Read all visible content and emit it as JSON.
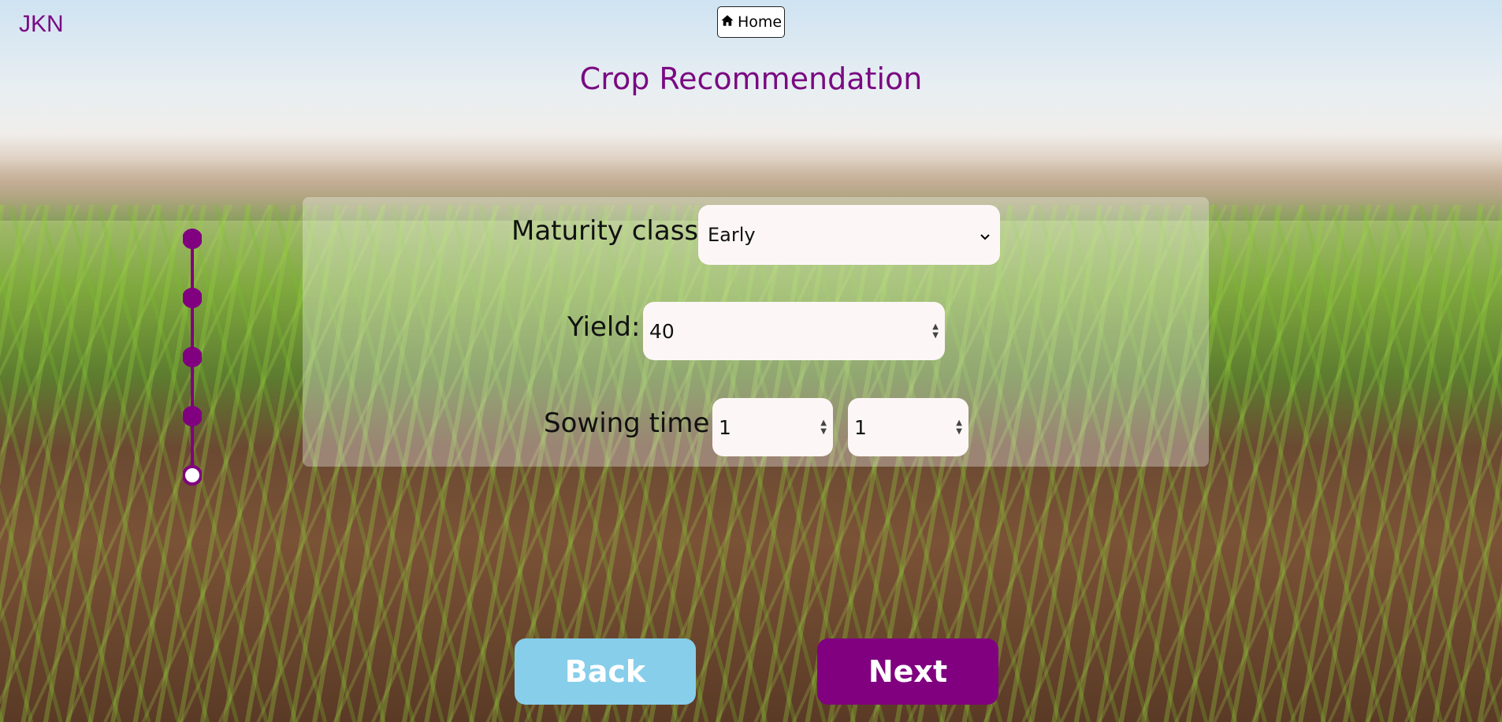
{
  "logo": "JKN",
  "home": {
    "label": "Home",
    "icon": "home-icon"
  },
  "title": "Crop Recommendation",
  "form": {
    "maturity_label": "Maturity class:",
    "maturity_value": "Early",
    "yield_label": "Yield:",
    "yield_value": "40",
    "sowing_label": "Sowing time:",
    "sowing_value_1": "1",
    "sowing_value_2": "1"
  },
  "progress": {
    "steps_total": 5,
    "current_step": 5
  },
  "buttons": {
    "back": "Back",
    "next": "Next"
  },
  "colors": {
    "accent": "#800080",
    "back": "#87ceeb",
    "title": "#7a0a82"
  }
}
